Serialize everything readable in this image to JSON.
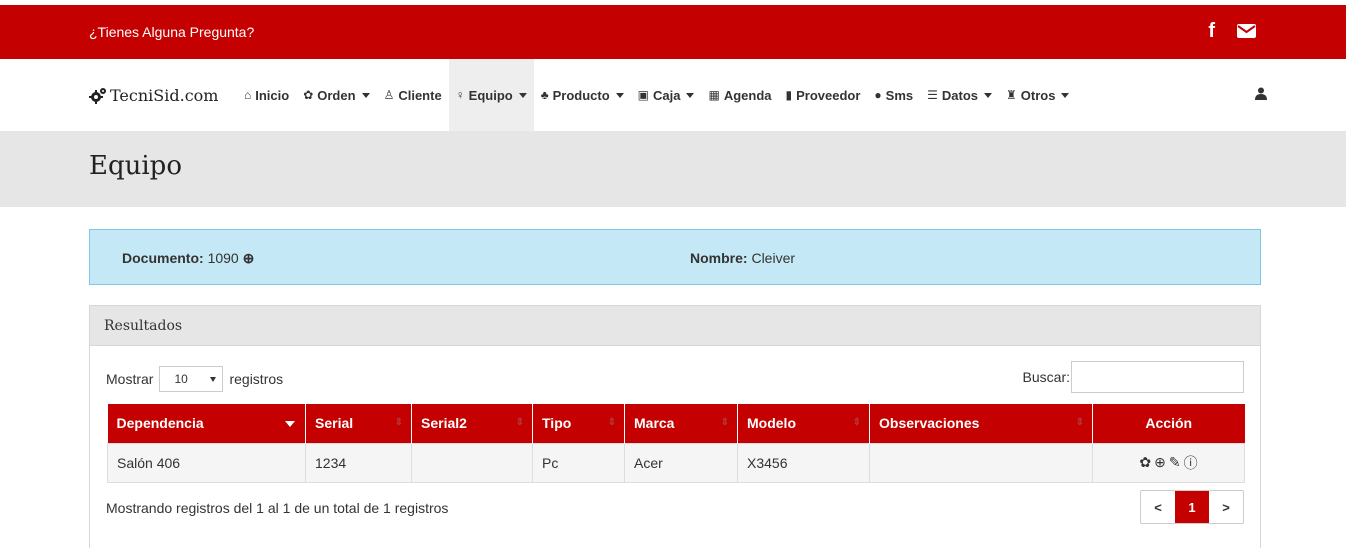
{
  "topbar": {
    "question": "¿Tienes Alguna Pregunta?",
    "facebook": "f"
  },
  "brand": {
    "name": "TecniSid.com"
  },
  "nav": {
    "inicio": "Inicio",
    "orden": "Orden",
    "cliente": "Cliente",
    "equipo": "Equipo",
    "producto": "Producto",
    "caja": "Caja",
    "agenda": "Agenda",
    "proveedor": "Proveedor",
    "sms": "Sms",
    "datos": "Datos",
    "otros": "Otros"
  },
  "page": {
    "title": "Equipo"
  },
  "info": {
    "documento_label": "Documento:",
    "documento_value": "1090",
    "nombre_label": "Nombre:",
    "nombre_value": "Cleiver"
  },
  "panel": {
    "heading": "Resultados",
    "mostrar": "Mostrar",
    "page_size": "10",
    "registros": "registros",
    "buscar": "Buscar:"
  },
  "table": {
    "headers": [
      "Dependencia",
      "Serial",
      "Serial2",
      "Tipo",
      "Marca",
      "Modelo",
      "Observaciones",
      "Acción"
    ],
    "rows": [
      {
        "dependencia": "Salón 406",
        "serial": "1234",
        "serial2": "",
        "tipo": "Pc",
        "marca": "Acer",
        "modelo": "X3456",
        "observaciones": ""
      }
    ]
  },
  "footer": {
    "info": "Mostrando registros del 1 al 1 de un total de 1 registros",
    "prev": "<",
    "current": "1",
    "next": ">"
  },
  "colors": {
    "brand_red": "#c40000",
    "info_bg": "#c5e8f6",
    "header_gray": "#e6e6e6"
  }
}
